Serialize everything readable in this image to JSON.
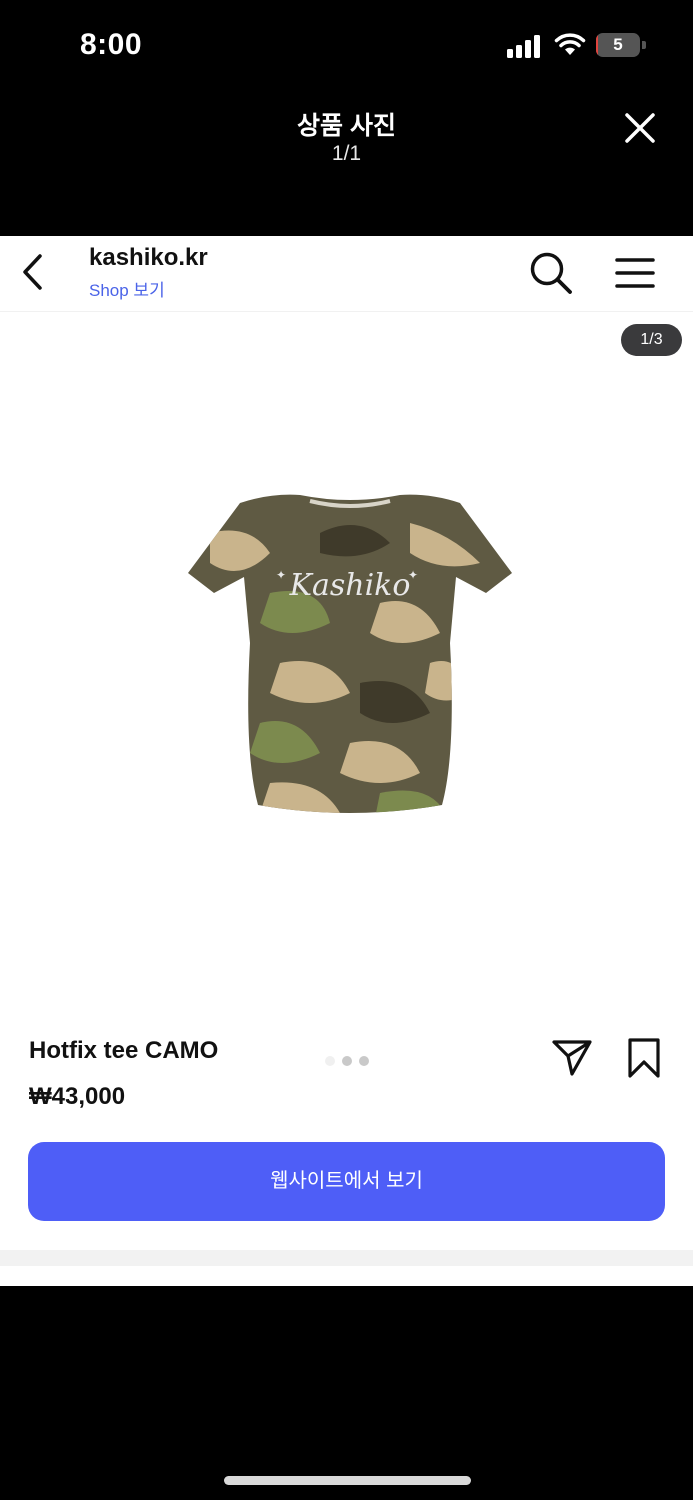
{
  "status_bar": {
    "time": "8:00",
    "battery_level": "5",
    "battery_color": "#e0443e"
  },
  "viewer": {
    "title": "상품 사진",
    "counter": "1/1"
  },
  "shop": {
    "name": "kashiko.kr",
    "link_label": "Shop 보기"
  },
  "gallery": {
    "counter": "1/3",
    "total": 3,
    "current": 1,
    "image_icon": "camo-tshirt-image",
    "image_text": "Kashiko"
  },
  "product": {
    "name": "Hotfix tee CAMO",
    "price": "₩43,000"
  },
  "cta": {
    "label": "웹사이트에서 보기",
    "color": "#4e5ef7"
  }
}
